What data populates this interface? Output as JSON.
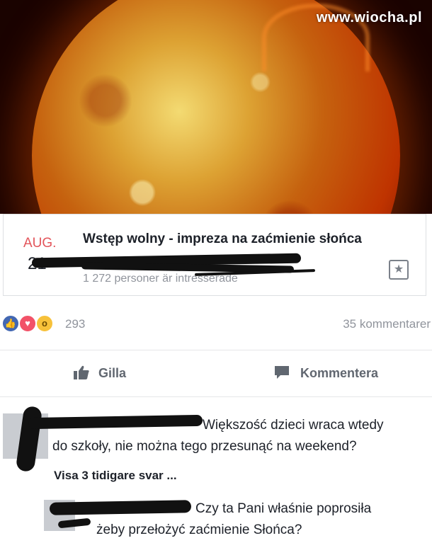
{
  "watermark": "www.wiocha.pl",
  "event": {
    "month": "AUG.",
    "day": "21",
    "title": "Wstęp wolny - impreza na zaćmienie słońca",
    "interested": "1 272 personer är intresserade"
  },
  "stats": {
    "reactions_count": "293",
    "comments_count": "35 kommentarer"
  },
  "actions": {
    "like_label": "Gilla",
    "comment_label": "Kommentera"
  },
  "comments": [
    {
      "text_line1": "Większość dzieci wraca wtedy",
      "text_line2": "do szkoły, nie można tego przesunąć na weekend?"
    }
  ],
  "replies_link": "Visa 3 tidigare svar ...",
  "reply": {
    "text_line1": "Czy ta Pani właśnie poprosiła",
    "text_line2": "żeby przełożyć zaćmienie Słońca?"
  },
  "colors": {
    "like_blue": "#4267b2",
    "love_red": "#f25268",
    "wow_yellow": "#f7c13a",
    "date_red": "#e3545a",
    "muted_text": "#90949c"
  },
  "icons": [
    "like-reaction-icon",
    "love-reaction-icon",
    "wow-reaction-icon",
    "thumbs-up-icon",
    "comment-bubble-icon",
    "star-icon"
  ]
}
